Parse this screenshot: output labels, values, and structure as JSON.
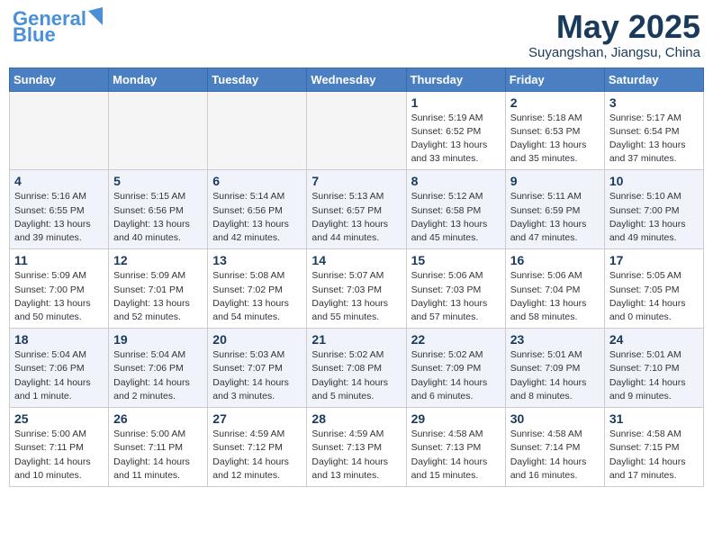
{
  "header": {
    "logo_line1": "General",
    "logo_line2": "Blue",
    "month": "May 2025",
    "location": "Suyangshan, Jiangsu, China"
  },
  "days_of_week": [
    "Sunday",
    "Monday",
    "Tuesday",
    "Wednesday",
    "Thursday",
    "Friday",
    "Saturday"
  ],
  "weeks": [
    [
      {
        "day": "",
        "info": ""
      },
      {
        "day": "",
        "info": ""
      },
      {
        "day": "",
        "info": ""
      },
      {
        "day": "",
        "info": ""
      },
      {
        "day": "1",
        "info": "Sunrise: 5:19 AM\nSunset: 6:52 PM\nDaylight: 13 hours\nand 33 minutes."
      },
      {
        "day": "2",
        "info": "Sunrise: 5:18 AM\nSunset: 6:53 PM\nDaylight: 13 hours\nand 35 minutes."
      },
      {
        "day": "3",
        "info": "Sunrise: 5:17 AM\nSunset: 6:54 PM\nDaylight: 13 hours\nand 37 minutes."
      }
    ],
    [
      {
        "day": "4",
        "info": "Sunrise: 5:16 AM\nSunset: 6:55 PM\nDaylight: 13 hours\nand 39 minutes."
      },
      {
        "day": "5",
        "info": "Sunrise: 5:15 AM\nSunset: 6:56 PM\nDaylight: 13 hours\nand 40 minutes."
      },
      {
        "day": "6",
        "info": "Sunrise: 5:14 AM\nSunset: 6:56 PM\nDaylight: 13 hours\nand 42 minutes."
      },
      {
        "day": "7",
        "info": "Sunrise: 5:13 AM\nSunset: 6:57 PM\nDaylight: 13 hours\nand 44 minutes."
      },
      {
        "day": "8",
        "info": "Sunrise: 5:12 AM\nSunset: 6:58 PM\nDaylight: 13 hours\nand 45 minutes."
      },
      {
        "day": "9",
        "info": "Sunrise: 5:11 AM\nSunset: 6:59 PM\nDaylight: 13 hours\nand 47 minutes."
      },
      {
        "day": "10",
        "info": "Sunrise: 5:10 AM\nSunset: 7:00 PM\nDaylight: 13 hours\nand 49 minutes."
      }
    ],
    [
      {
        "day": "11",
        "info": "Sunrise: 5:09 AM\nSunset: 7:00 PM\nDaylight: 13 hours\nand 50 minutes."
      },
      {
        "day": "12",
        "info": "Sunrise: 5:09 AM\nSunset: 7:01 PM\nDaylight: 13 hours\nand 52 minutes."
      },
      {
        "day": "13",
        "info": "Sunrise: 5:08 AM\nSunset: 7:02 PM\nDaylight: 13 hours\nand 54 minutes."
      },
      {
        "day": "14",
        "info": "Sunrise: 5:07 AM\nSunset: 7:03 PM\nDaylight: 13 hours\nand 55 minutes."
      },
      {
        "day": "15",
        "info": "Sunrise: 5:06 AM\nSunset: 7:03 PM\nDaylight: 13 hours\nand 57 minutes."
      },
      {
        "day": "16",
        "info": "Sunrise: 5:06 AM\nSunset: 7:04 PM\nDaylight: 13 hours\nand 58 minutes."
      },
      {
        "day": "17",
        "info": "Sunrise: 5:05 AM\nSunset: 7:05 PM\nDaylight: 14 hours\nand 0 minutes."
      }
    ],
    [
      {
        "day": "18",
        "info": "Sunrise: 5:04 AM\nSunset: 7:06 PM\nDaylight: 14 hours\nand 1 minute."
      },
      {
        "day": "19",
        "info": "Sunrise: 5:04 AM\nSunset: 7:06 PM\nDaylight: 14 hours\nand 2 minutes."
      },
      {
        "day": "20",
        "info": "Sunrise: 5:03 AM\nSunset: 7:07 PM\nDaylight: 14 hours\nand 3 minutes."
      },
      {
        "day": "21",
        "info": "Sunrise: 5:02 AM\nSunset: 7:08 PM\nDaylight: 14 hours\nand 5 minutes."
      },
      {
        "day": "22",
        "info": "Sunrise: 5:02 AM\nSunset: 7:09 PM\nDaylight: 14 hours\nand 6 minutes."
      },
      {
        "day": "23",
        "info": "Sunrise: 5:01 AM\nSunset: 7:09 PM\nDaylight: 14 hours\nand 8 minutes."
      },
      {
        "day": "24",
        "info": "Sunrise: 5:01 AM\nSunset: 7:10 PM\nDaylight: 14 hours\nand 9 minutes."
      }
    ],
    [
      {
        "day": "25",
        "info": "Sunrise: 5:00 AM\nSunset: 7:11 PM\nDaylight: 14 hours\nand 10 minutes."
      },
      {
        "day": "26",
        "info": "Sunrise: 5:00 AM\nSunset: 7:11 PM\nDaylight: 14 hours\nand 11 minutes."
      },
      {
        "day": "27",
        "info": "Sunrise: 4:59 AM\nSunset: 7:12 PM\nDaylight: 14 hours\nand 12 minutes."
      },
      {
        "day": "28",
        "info": "Sunrise: 4:59 AM\nSunset: 7:13 PM\nDaylight: 14 hours\nand 13 minutes."
      },
      {
        "day": "29",
        "info": "Sunrise: 4:58 AM\nSunset: 7:13 PM\nDaylight: 14 hours\nand 15 minutes."
      },
      {
        "day": "30",
        "info": "Sunrise: 4:58 AM\nSunset: 7:14 PM\nDaylight: 14 hours\nand 16 minutes."
      },
      {
        "day": "31",
        "info": "Sunrise: 4:58 AM\nSunset: 7:15 PM\nDaylight: 14 hours\nand 17 minutes."
      }
    ]
  ]
}
